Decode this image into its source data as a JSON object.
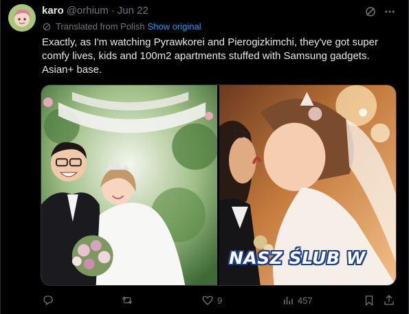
{
  "post": {
    "author_name": "karo",
    "handle": "@orhium",
    "separator": "·",
    "date": "Jun 22",
    "translation_note": "Translated from Polish",
    "show_original": "Show original",
    "text_lines": [
      "Exactly, as I'm watching Pyrawkorei and Pierogizkimchi, they've got super",
      "comfy lives, kids and 100m2 apartments stuffed with Samsung gadgets.",
      "Asian+ base."
    ],
    "media_overlay_text": "NASZ ŚLUB W"
  },
  "actions": {
    "reply_count": "",
    "repost_count": "",
    "like_count": "9",
    "views_count": "457"
  },
  "icons": {
    "grok": "grok-icon",
    "more": "more-icon",
    "translate": "translate-icon",
    "reply": "reply-icon",
    "repost": "repost-icon",
    "like": "like-icon",
    "views": "views-icon",
    "bookmark": "bookmark-icon",
    "share": "share-icon"
  },
  "colors": {
    "background": "#000000",
    "text": "#e7e9ea",
    "muted": "#71767b",
    "link": "#1d9bf0",
    "border": "#2f3336"
  }
}
